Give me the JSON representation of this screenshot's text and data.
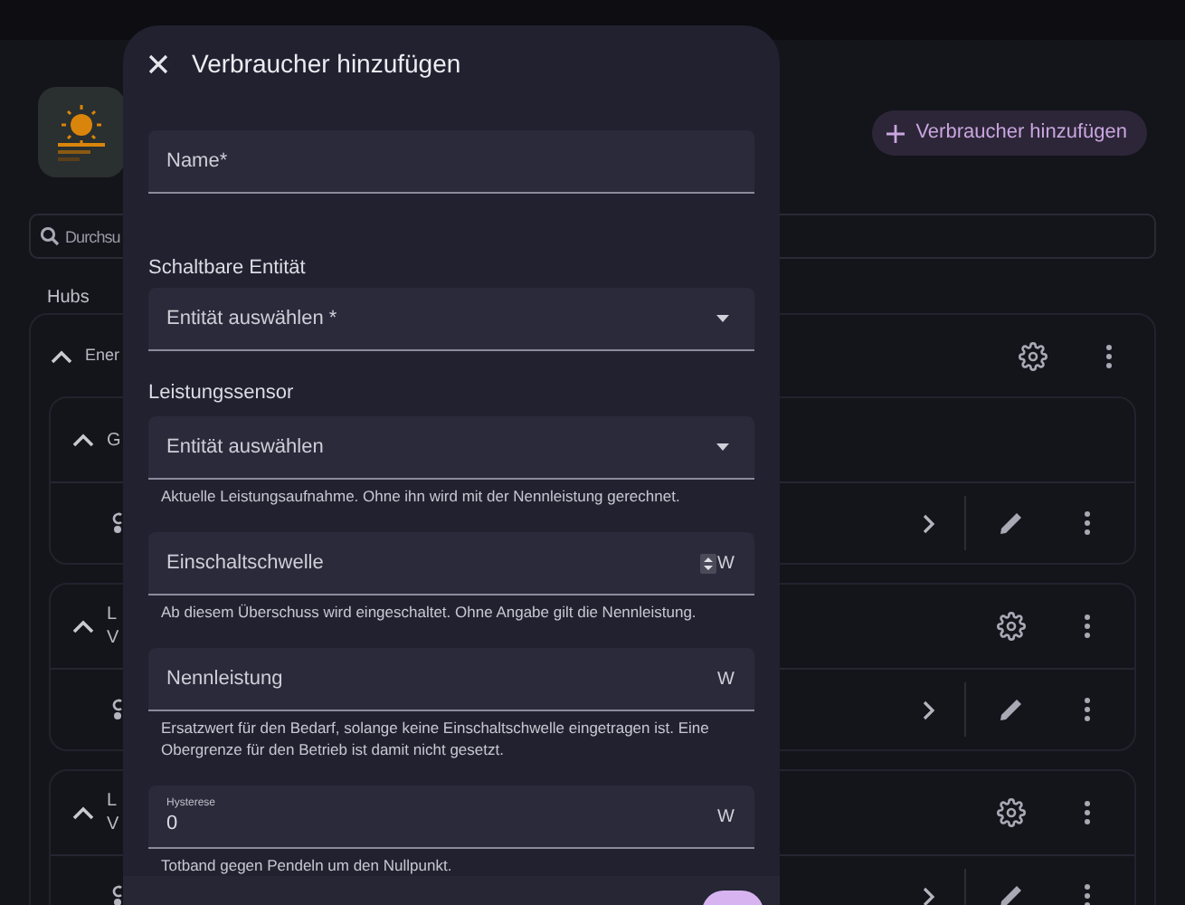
{
  "add_button": {
    "label": "Verbraucher hinzufügen"
  },
  "search": {
    "placeholder": "Durchsu"
  },
  "section_title": "Hubs",
  "hub": {
    "title": "Ener",
    "groups": [
      {
        "title": "G",
        "has_settings": false
      },
      {
        "title": "L",
        "subtitle": "V",
        "has_settings": true
      },
      {
        "title": "L",
        "subtitle": "V",
        "has_settings": true
      }
    ]
  },
  "dialog": {
    "title": "Verbraucher hinzufügen",
    "fields": [
      {
        "kind": "text",
        "label": "Name*"
      },
      {
        "kind": "section",
        "label": "Schaltbare Entität"
      },
      {
        "kind": "select",
        "label": "Entität auswählen *"
      },
      {
        "kind": "section",
        "label": "Leistungssensor"
      },
      {
        "kind": "select",
        "label": "Entität auswählen",
        "helper": "Aktuelle Leistungsaufnahme. Ohne ihn wird mit der Nennleistung gerechnet."
      },
      {
        "kind": "number",
        "label": "Einschaltschwelle",
        "unit": "W",
        "spinner": true,
        "helper": "Ab diesem Überschuss wird eingeschaltet. Ohne Angabe gilt die Nennleistung."
      },
      {
        "kind": "number",
        "label": "Nennleistung",
        "unit": "W",
        "spinner": false,
        "helper": "Ersatzwert für den Bedarf, solange keine Einschaltschwelle eingetragen ist. Eine Obergrenze für den Betrieb ist damit nicht gesetzt."
      },
      {
        "kind": "number",
        "label": "Hysterese",
        "value": "0",
        "unit": "W",
        "spinner": false,
        "helper": "Totband gegen Pendeln um den Nullpunkt."
      }
    ]
  }
}
